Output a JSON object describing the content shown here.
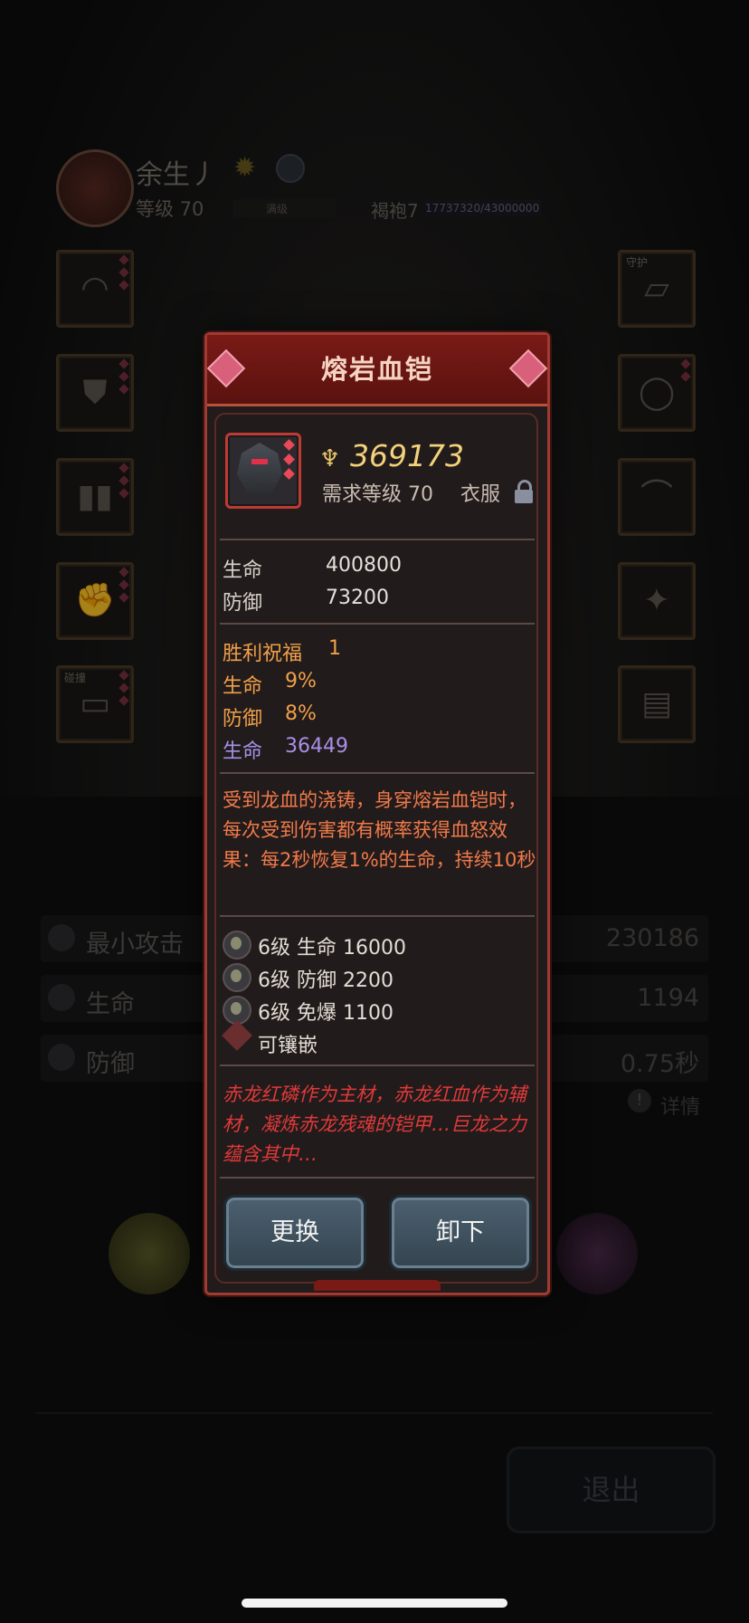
{
  "hero": {
    "name": "余生丿",
    "level": "等级 70",
    "xp_label": "满级",
    "rank": "褐袍7",
    "rank_progress": "17737320/43000000"
  },
  "slots": {
    "right_top_tag": "守护",
    "left_bottom_tag": "碰撞"
  },
  "stats": [
    {
      "label": "最小攻击",
      "value": "230186"
    },
    {
      "label": "生命",
      "value": "1194"
    },
    {
      "label": "防御",
      "value": "0.75秒"
    }
  ],
  "detail_link": "详情",
  "exit_button": "退出",
  "popup": {
    "title": "熔岩血铠",
    "power": "369173",
    "requirement": "需求等级 70",
    "slot_type": "衣服",
    "base_stats": [
      {
        "label": "生命",
        "value": "400800"
      },
      {
        "label": "防御",
        "value": "73200"
      }
    ],
    "bonus": {
      "blessing_label": "胜利祝福",
      "blessing_value": "1",
      "hp_pct_label": "生命",
      "hp_pct_value": "9%",
      "def_pct_label": "防御",
      "def_pct_value": "8%",
      "hp_flat_label": "生命",
      "hp_flat_value": "36449"
    },
    "description": "受到龙血的浇铸，身穿熔岩血铠时，每次受到伤害都有概率获得血怒效果：每2秒恢复1%的生命，持续10秒",
    "gems": [
      {
        "text": "6级   生命 16000"
      },
      {
        "text": "6级   防御 2200"
      },
      {
        "text": "6级   免爆 1100"
      }
    ],
    "socket_label": "可镶嵌",
    "flavor": "赤龙红磷作为主材，赤龙红血作为辅材，凝炼赤龙残魂的铠甲…巨龙之力蕴含其中…",
    "buttons": {
      "replace": "更换",
      "unequip": "卸下"
    }
  }
}
